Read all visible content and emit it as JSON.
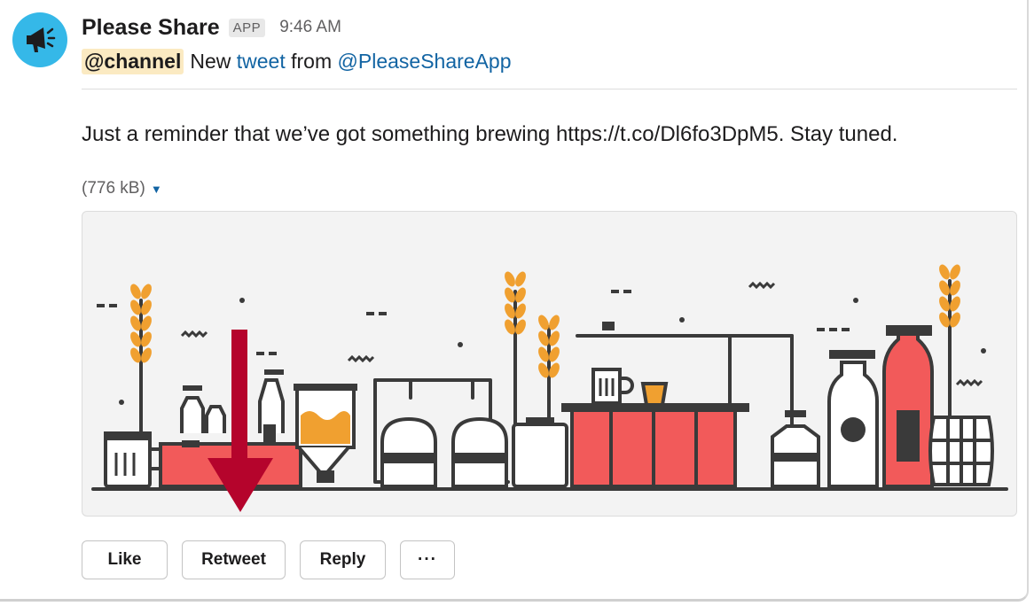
{
  "message": {
    "sender": "Please Share",
    "badge": "APP",
    "time": "9:46 AM",
    "mention": "@channel",
    "prefix": "New",
    "tweet_link": "tweet",
    "from_word": "from",
    "account_link": "@PleaseShareApp",
    "body": "Just a reminder that we’ve got something brewing https://t.co/Dl6fo3DpM5. Stay tuned.",
    "file_size": "(776 kB)"
  },
  "actions": {
    "like": "Like",
    "retweet": "Retweet",
    "reply": "Reply",
    "more": "···"
  },
  "colors": {
    "avatar": "#35b8e8",
    "accent_red": "#f25a5a",
    "wheat": "#f0a030",
    "arrow": "#b5042c",
    "link": "#1264a3",
    "mention_bg": "#fbeac2"
  },
  "icons": {
    "avatar": "megaphone-icon",
    "file_toggle": "caret-down-icon",
    "annotation": "arrow-down-icon"
  }
}
